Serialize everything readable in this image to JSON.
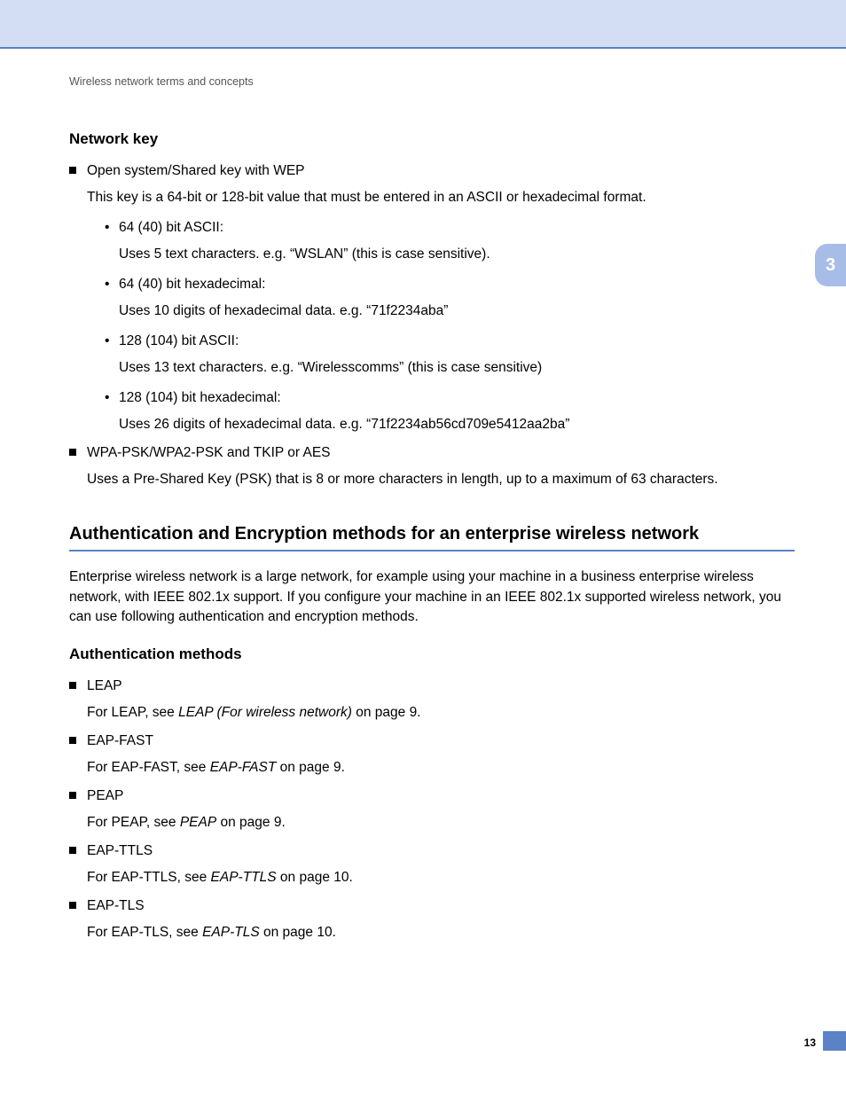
{
  "header_band": true,
  "breadcrumb": "Wireless network terms and concepts",
  "side_tab": "3",
  "page_number": "13",
  "network_key": {
    "heading": "Network key",
    "items": [
      {
        "title": "Open system/Shared key with WEP",
        "body": "This key is a 64-bit or 128-bit value that must be entered in an ASCII or hexadecimal format.",
        "sub": [
          {
            "title": "64 (40) bit ASCII:",
            "body": "Uses 5 text characters. e.g. “WSLAN” (this is case sensitive)."
          },
          {
            "title": "64 (40) bit hexadecimal:",
            "body": "Uses 10 digits of hexadecimal data. e.g. “71f2234aba”"
          },
          {
            "title": "128 (104) bit ASCII:",
            "body": "Uses 13 text characters. e.g. “Wirelesscomms” (this is case sensitive)"
          },
          {
            "title": "128 (104) bit hexadecimal:",
            "body": "Uses 26 digits of hexadecimal data. e.g. “71f2234ab56cd709e5412aa2ba”"
          }
        ]
      },
      {
        "title": "WPA-PSK/WPA2-PSK and TKIP or AES",
        "body": "Uses a Pre-Shared Key (PSK) that is 8 or more characters in length, up to a maximum of 63 characters."
      }
    ]
  },
  "auth_section": {
    "heading": "Authentication and Encryption methods for an enterprise wireless network",
    "intro": "Enterprise wireless network is a large network, for example using your machine in a business enterprise wireless network, with IEEE 802.1x support. If you configure your machine in an IEEE 802.1x supported wireless network, you can use following authentication and encryption methods.",
    "sub_heading": "Authentication methods",
    "items": [
      {
        "title": "LEAP",
        "pre": "For LEAP, see ",
        "ref": "LEAP (For wireless network)",
        "post": " on page 9."
      },
      {
        "title": "EAP-FAST",
        "pre": "For EAP-FAST, see ",
        "ref": "EAP-FAST",
        "post": " on page 9."
      },
      {
        "title": "PEAP",
        "pre": "For PEAP, see ",
        "ref": "PEAP",
        "post": " on page 9."
      },
      {
        "title": "EAP-TTLS",
        "pre": "For EAP-TTLS, see ",
        "ref": "EAP-TTLS",
        "post": " on page 10."
      },
      {
        "title": "EAP-TLS",
        "pre": "For EAP-TLS, see ",
        "ref": "EAP-TLS",
        "post": " on page 10."
      }
    ]
  }
}
